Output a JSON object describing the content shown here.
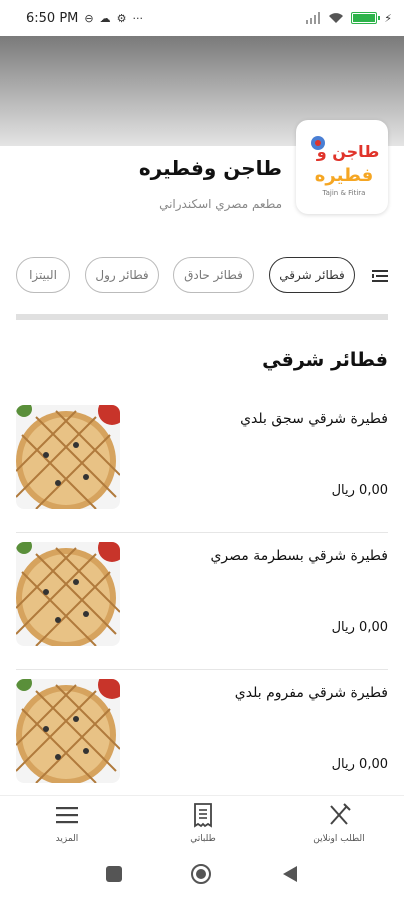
{
  "status_bar": {
    "time": "6:50 PM"
  },
  "restaurant": {
    "name": "طاجن وفطيره",
    "subtitle": "مطعم مصري اسكندراني",
    "logo_text_line1": "طاجن و",
    "logo_text_line2": "فطيره",
    "logo_caption": "Tajin & Fitira"
  },
  "categories": [
    {
      "label": "فطائر شرقي",
      "active": true
    },
    {
      "label": "فطائر حادق",
      "active": false
    },
    {
      "label": "فطائر رول",
      "active": false
    },
    {
      "label": "البيتزا",
      "active": false
    }
  ],
  "section": {
    "title": "فطائر شرقي"
  },
  "items": [
    {
      "name": "فطيرة شرقي  سجق بلدي",
      "price": "0,00 ريال"
    },
    {
      "name": "فطيرة شرقي بسطرمة مصري",
      "price": "0,00 ريال"
    },
    {
      "name": "فطيرة شرقي مفروم بلدي",
      "price": "0,00 ريال"
    }
  ],
  "bottom_nav": [
    {
      "label": "الطلب اونلاين",
      "icon": "fork-knife-icon"
    },
    {
      "label": "طلباتي",
      "icon": "receipt-icon"
    },
    {
      "label": "المزيد",
      "icon": "menu-icon"
    }
  ],
  "colors": {
    "battery": "#2db34a",
    "logo_orange": "#f5a623",
    "logo_red": "#e0342b"
  }
}
